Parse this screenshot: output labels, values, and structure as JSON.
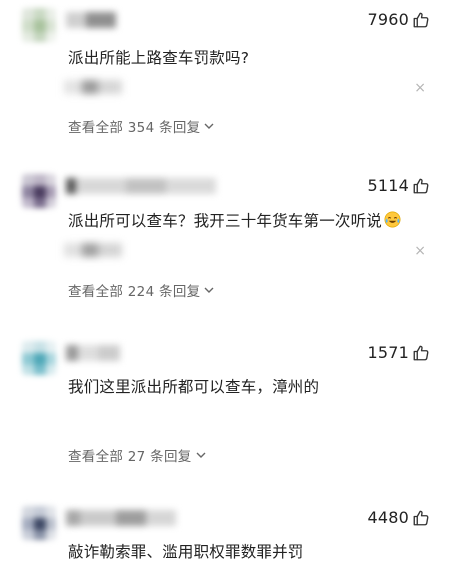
{
  "comments": [
    {
      "likes": "7960",
      "text": "派出所能上路查车罚款吗?",
      "view_all": "查看全部 354 条回复",
      "has_reply_preview": true
    },
    {
      "likes": "5114",
      "text": "派出所可以查车？我开三十年货车第一次听说",
      "emoji": "laughing-crying-emoji",
      "view_all": "查看全部 224 条回复",
      "has_reply_preview": true
    },
    {
      "likes": "1571",
      "text": "我们这里派出所都可以查车，漳州的",
      "view_all": "查看全部 27 条回复",
      "has_reply_preview": false
    },
    {
      "likes": "4480",
      "text": "敲诈勒索罪、滥用职权罪数罪并罚"
    }
  ],
  "icons": {
    "like": "thumbs-up-icon",
    "close": "close-icon",
    "expand": "chevron-down-icon"
  },
  "colors": {
    "text": "#222222",
    "secondary": "#666666",
    "muted": "#b5b5b5"
  },
  "close_glyph": "×"
}
